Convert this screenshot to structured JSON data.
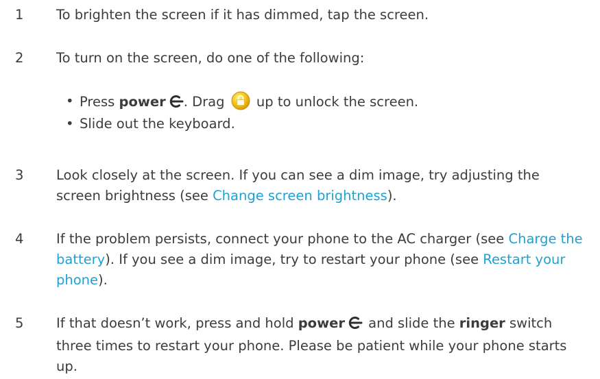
{
  "steps": [
    {
      "num": "1",
      "text": "To brighten the screen if it has dimmed, tap the screen."
    },
    {
      "num": "2",
      "text": "To turn on the screen, do one of the following:"
    },
    {
      "num": "3",
      "t1": "Look closely at the screen. If you can see a dim image, try adjusting the screen brightness (see ",
      "link1": "Change screen brightness",
      "t2": ")."
    },
    {
      "num": "4",
      "t1": "If the problem persists, connect your phone to the AC charger (see ",
      "link1": "Charge the battery",
      "t2": "). If you see a dim image, try to restart your phone (see ",
      "link2": "Restart your phone",
      "t3": ")."
    },
    {
      "num": "5",
      "t1": "If that doesn’t work, press and hold ",
      "b1": "power",
      "t2": " and slide the ",
      "b2": "ringer",
      "t3": " switch three times to restart your phone. Please be patient while your phone starts up."
    }
  ],
  "bullets": [
    {
      "dot": "•",
      "t1": "Press ",
      "b1": "power",
      "t2": ". Drag ",
      "t3": " up to unlock the screen."
    },
    {
      "dot": "•",
      "text": "Slide out the keyboard."
    }
  ],
  "colors": {
    "text": "#3c3c3c",
    "link": "#1ea1d3",
    "lock_gold": "#f2c21a"
  },
  "icons": {
    "power": "power-icon",
    "lock": "unlock-padlock-icon"
  }
}
